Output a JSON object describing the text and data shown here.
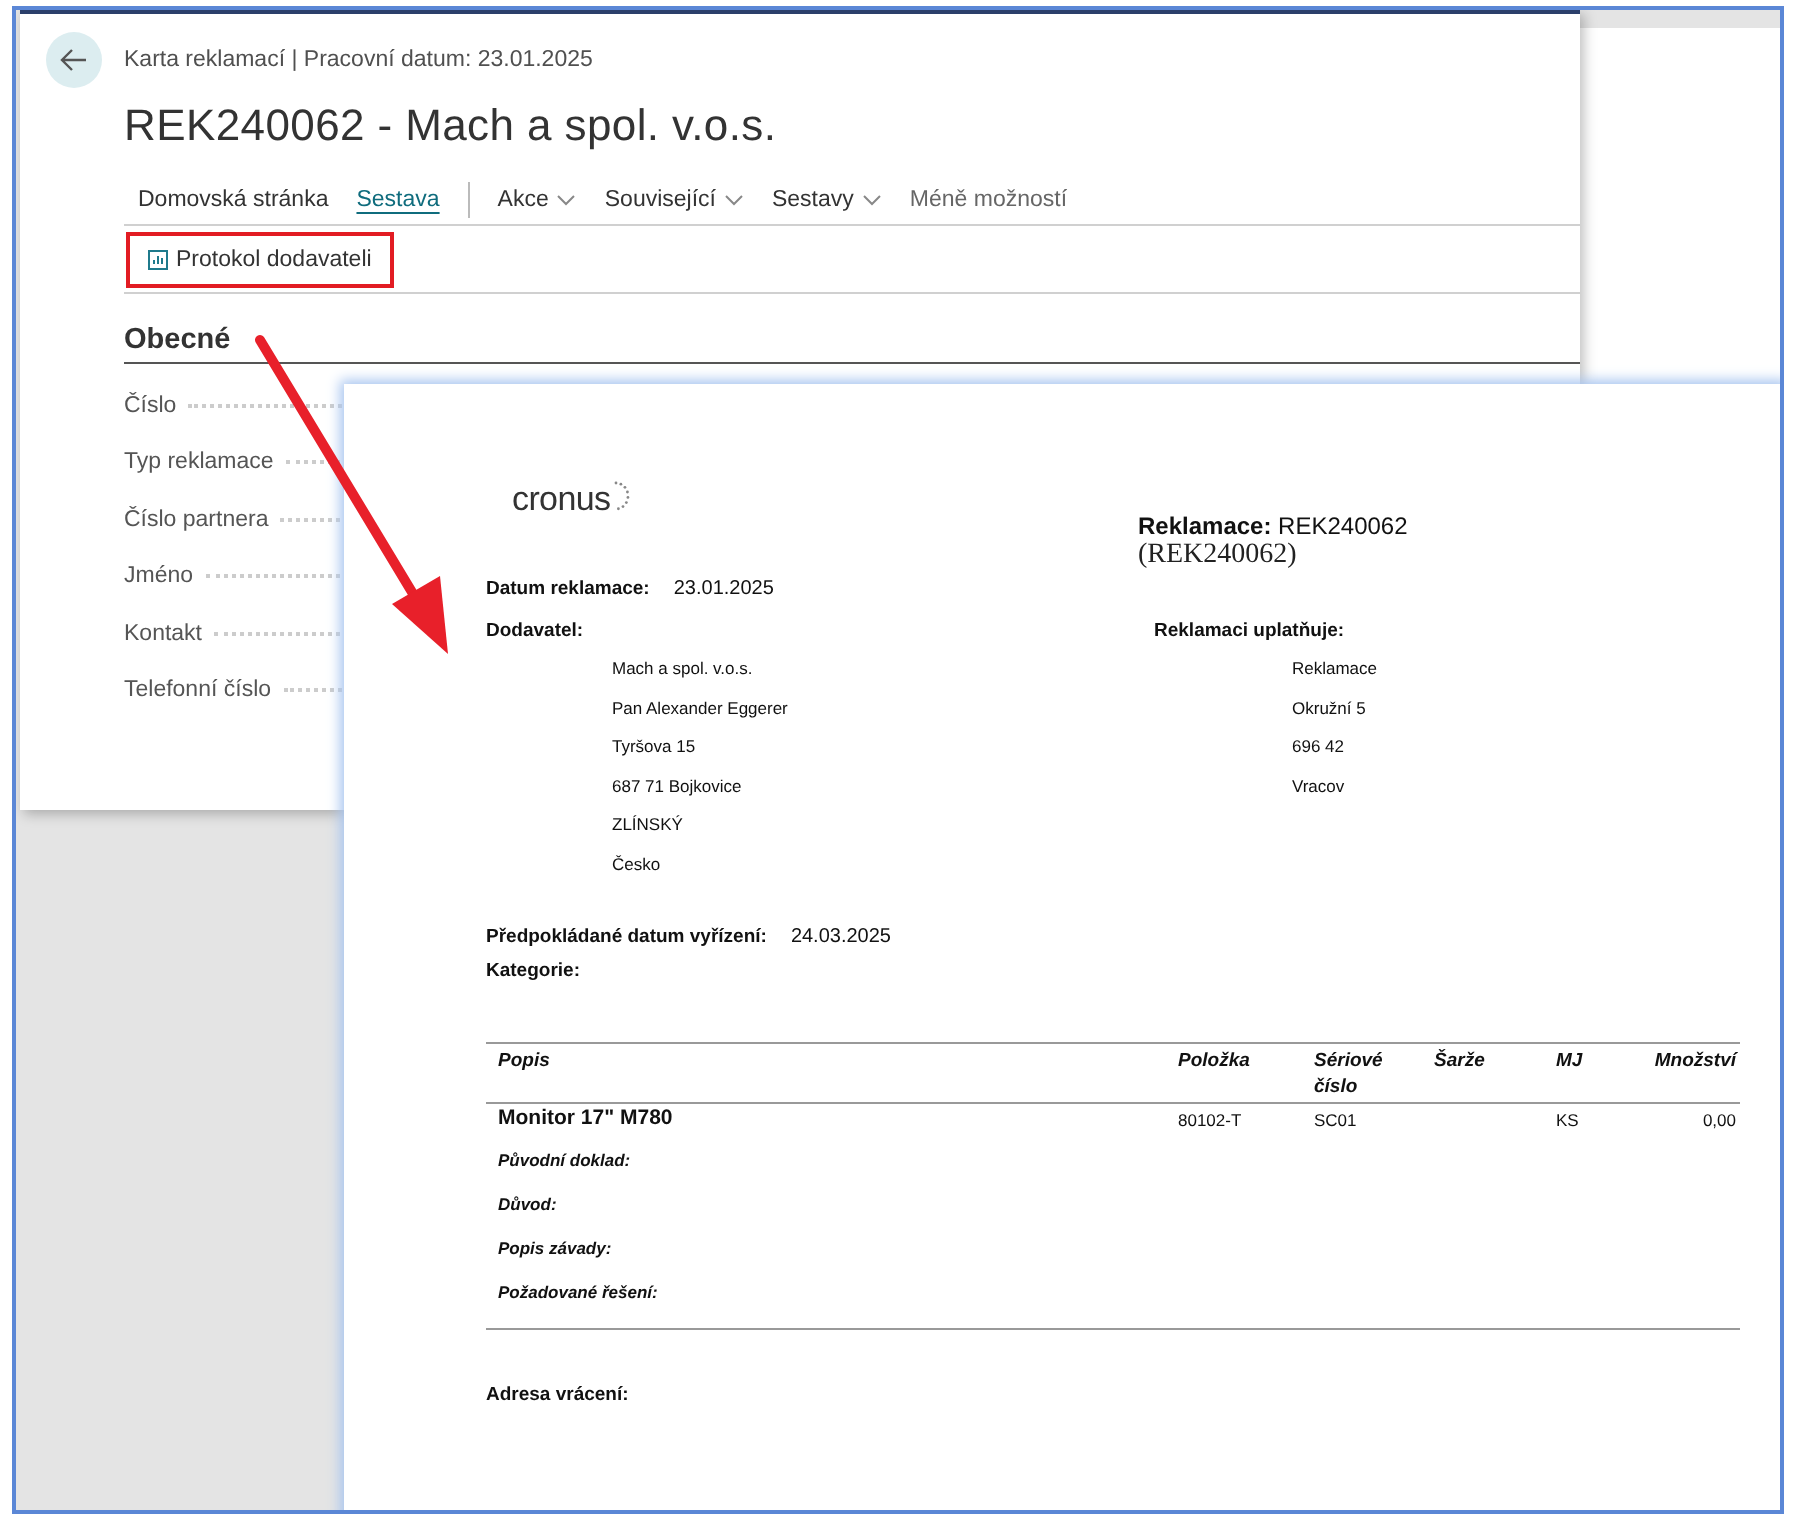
{
  "card_window": {
    "breadcrumb": "Karta reklamací | Pracovní datum: 23.01.2025",
    "title": "REK240062 - Mach a spol. v.o.s.",
    "tabs": [
      {
        "label": "Domovská stránka",
        "selected": false
      },
      {
        "label": "Sestava",
        "selected": true
      }
    ],
    "menus": [
      {
        "label": "Akce",
        "kind": "dropdown"
      },
      {
        "label": "Související",
        "kind": "dropdown"
      },
      {
        "label": "Sestavy",
        "kind": "dropdown"
      },
      {
        "label": "Méně možností",
        "kind": "link"
      }
    ],
    "actions": [
      {
        "label": "Protokol dodavateli",
        "highlighted": true
      }
    ],
    "section": {
      "title": "Obecné",
      "fields": [
        {
          "label": "Číslo"
        },
        {
          "label": "Typ reklamace"
        },
        {
          "label": "Číslo partnera"
        },
        {
          "label": "Jméno"
        },
        {
          "label": "Kontakt"
        },
        {
          "label": "Telefonní číslo"
        }
      ]
    }
  },
  "report": {
    "logo": "cronus",
    "title": "**Reklamace:** REK240062",
    "subtitle": "(REK240062)",
    "claim_date": {
      "label": "Datum reklamace:",
      "value": "23.01.2025"
    },
    "supplier": {
      "label": "Dodavatel:",
      "lines": [
        "Mach a spol. v.o.s.",
        "Pan Alexander Eggerer",
        "Tyršova 15",
        "687 71 Bojkovice",
        "ZLÍNSKÝ",
        "Česko"
      ]
    },
    "claimant": {
      "label": "Reklamaci uplatňuje:",
      "lines": [
        "Reklamace",
        "Okružní 5",
        "696 42",
        "Vracov"
      ]
    },
    "due_date": {
      "label": "Předpokládané datum vyřízení:",
      "value": "24.03.2025"
    },
    "category": {
      "label": "Kategorie:"
    },
    "table": {
      "columns": [
        "Popis",
        "Položka",
        "Sériové číslo",
        "Šarže",
        "MJ",
        "Množství"
      ],
      "rows": [
        {
          "description": "Monitor 17\" M780",
          "item": "80102-T",
          "serial": "SC01",
          "unit": "KS",
          "quantity": "0,00",
          "details": [
            "Původní doklad:",
            "Důvod:",
            "Popis závady:",
            "Požadované řešení:"
          ]
        }
      ]
    },
    "return_address": {
      "label": "Adresa vrácení:"
    }
  }
}
